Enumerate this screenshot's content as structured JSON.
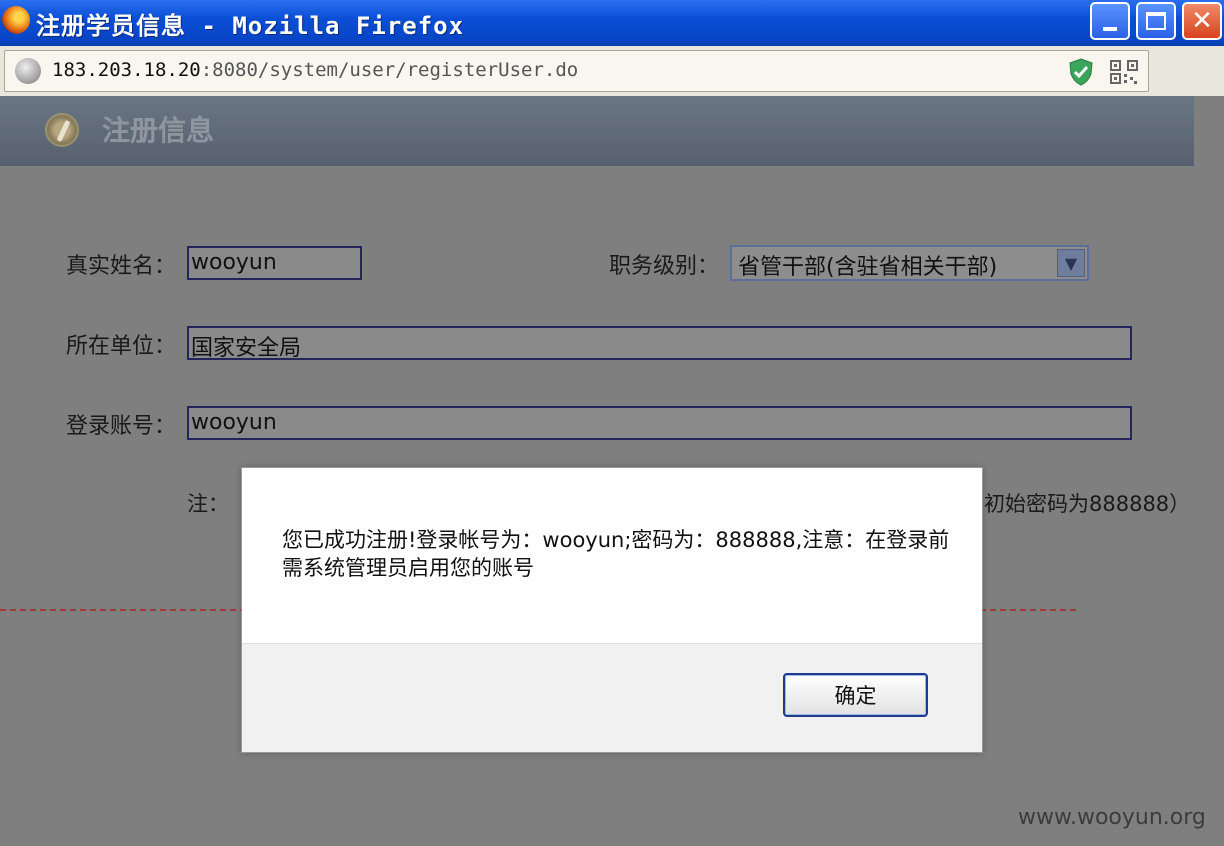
{
  "window": {
    "title": "注册学员信息 - Mozilla Firefox",
    "controls": {
      "minimize_icon": "minimize-icon",
      "maximize_icon": "maximize-icon",
      "close_label": "✕"
    }
  },
  "addressbar": {
    "url_host": "183.203.18.20",
    "url_rest": ":8080/system/user/registerUser.do",
    "icons": [
      "globe-icon",
      "shield-icon",
      "qr-code-icon"
    ]
  },
  "page": {
    "title": "注册信息",
    "form": {
      "real_name_label": "真实姓名：",
      "real_name_value": "wooyun",
      "rank_label": "职务级别：",
      "rank_value": "省管干部(含驻省相关干部)",
      "org_label": "所在单位：",
      "org_value": "国家安全局",
      "account_label": "登录账号：",
      "account_value": "wooyun",
      "note_left": "注：",
      "note_right": "初始密码为888888）"
    }
  },
  "dialog": {
    "message": "您已成功注册!登录帐号为：wooyun;密码为：888888,注意：在登录前需系统管理员启用您的账号",
    "ok_label": "确定"
  },
  "watermark": "www.wooyun.org",
  "colors": {
    "titlebar": "#0a4fd6",
    "overlay": "#7f7f7f",
    "header_band": "#5f6977",
    "dash": "#a03a3a"
  }
}
